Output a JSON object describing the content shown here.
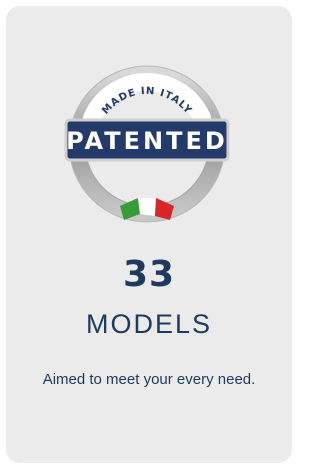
{
  "card": {
    "badge": {
      "ring_text": "MADE IN ITALY",
      "label": "PATENTED",
      "flag_colors": [
        "#3a9a3a",
        "#ffffff",
        "#d8252b"
      ]
    },
    "count": "33",
    "unit": "MODELS",
    "description": "Aimed to meet your every need."
  },
  "colors": {
    "background": "#ebebeb",
    "text": "#1f3a5f",
    "badge_navy": "#233a6b"
  }
}
